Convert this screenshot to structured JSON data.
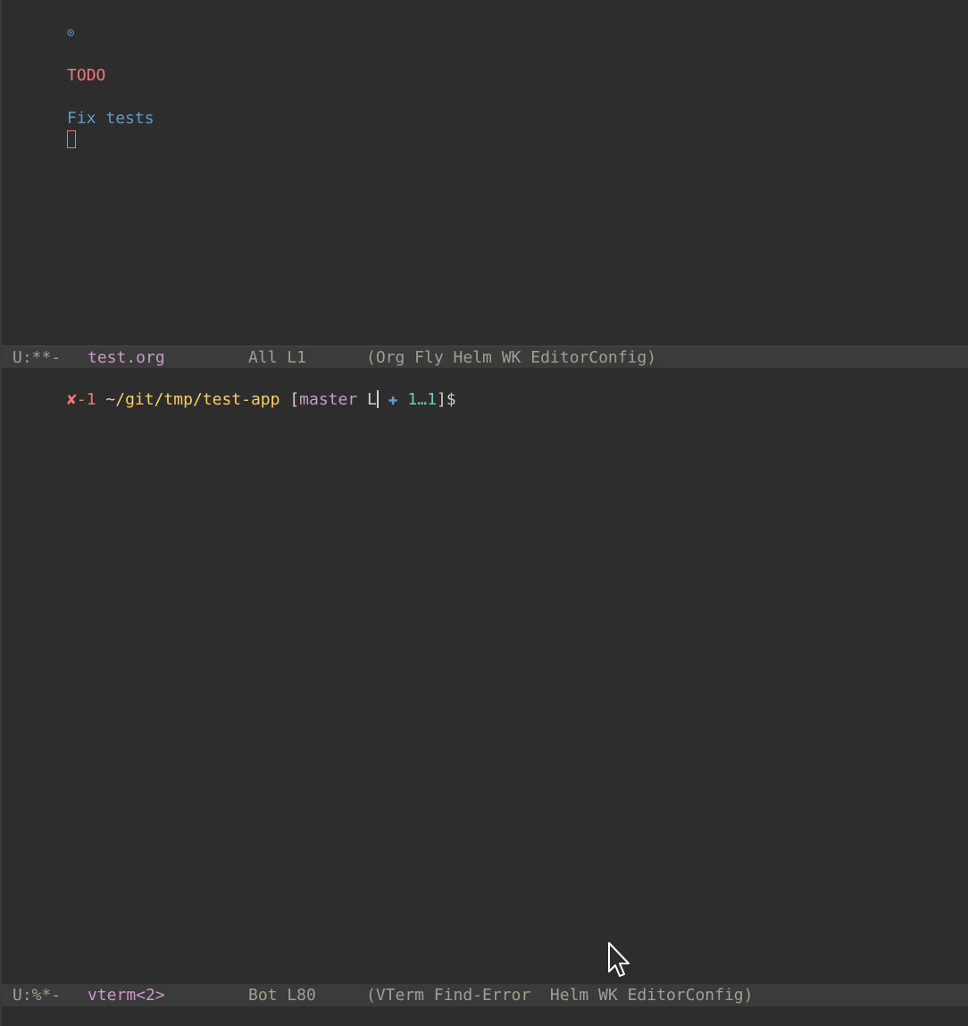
{
  "top_window": {
    "bullet_icon": "circled-dot-icon",
    "bullet_glyph": "⊙",
    "todo_keyword": "TODO",
    "heading_text": "Fix tests"
  },
  "top_modeline": {
    "state": "U:**-",
    "buffer": "test.org",
    "position": "All L1",
    "modes": "(Org Fly Helm WK EditorConfig)"
  },
  "terminal": {
    "err_mark": "✘",
    "exit_code": "-1",
    "path": "~/git/tmp/test-app",
    "open_bracket": "[",
    "branch": "master",
    "status_letter": "L",
    "plus_icon": "✚",
    "ahead_count": "1…1",
    "close_bracket": "]",
    "dollar": "$"
  },
  "bottom_modeline": {
    "state": "U:%*-",
    "buffer": "vterm<2>",
    "position": "Bot L80",
    "modes": "(VTerm Find-Error  Helm WK EditorConfig)"
  },
  "colors": {
    "background": "#2d2d2d",
    "modeline": "#3b3b3b",
    "todo_red": "#f2777a",
    "blue": "#6699cc",
    "yellow": "#ffcc66",
    "purple": "#cc99cc",
    "cyan": "#66cccc"
  }
}
